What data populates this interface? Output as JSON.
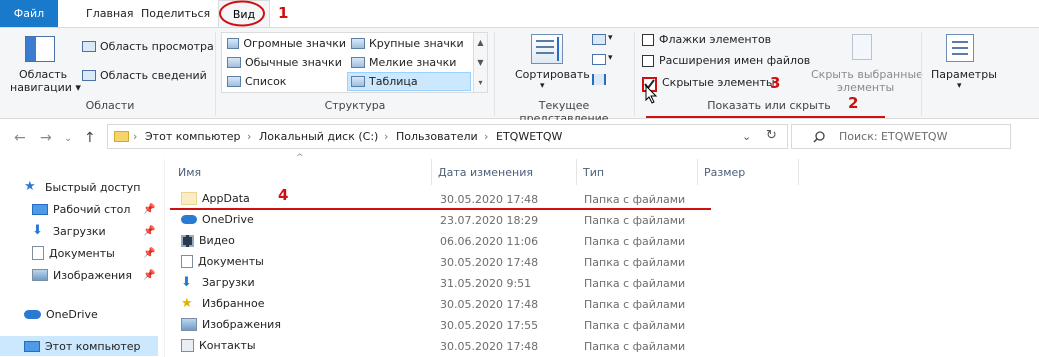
{
  "tabs": {
    "file": "Файл",
    "home": "Главная",
    "share": "Поделиться",
    "view": "Вид"
  },
  "ribbon": {
    "panes": {
      "nav_pane": [
        "Область",
        "навигации"
      ],
      "preview": "Область просмотра",
      "details": "Область сведений",
      "group_label": "Области"
    },
    "layout": {
      "items": [
        "Огромные значки",
        "Крупные значки",
        "Обычные значки",
        "Мелкие значки",
        "Список",
        "Таблица"
      ],
      "selected": "Таблица",
      "group_label": "Структура"
    },
    "current_view": {
      "sort": "Сортировать",
      "group_label": "Текущее представление"
    },
    "show_hide": {
      "item_checkboxes": "Флажки элементов",
      "file_extensions": "Расширения имен файлов",
      "hidden_items": "Скрытые элементы",
      "hidden_checked": true,
      "hide_selected": [
        "Скрыть выбранные",
        "элементы"
      ],
      "group_label": "Показать или скрыть"
    },
    "options": {
      "label": "Параметры"
    }
  },
  "address": {
    "crumbs": [
      "Этот компьютер",
      "Локальный диск (C:)",
      "Пользователи",
      "ETQWETQW"
    ],
    "search_placeholder": "Поиск: ETQWETQW"
  },
  "nav_pane_items": [
    {
      "label": "Быстрый доступ",
      "icon": "star-icon"
    },
    {
      "label": "Рабочий стол",
      "icon": "desktop-icon",
      "pinned": true
    },
    {
      "label": "Загрузки",
      "icon": "download-icon",
      "pinned": true
    },
    {
      "label": "Документы",
      "icon": "document-icon",
      "pinned": true
    },
    {
      "label": "Изображения",
      "icon": "pictures-icon",
      "pinned": true
    },
    {
      "label": "OneDrive",
      "icon": "cloud-icon"
    },
    {
      "label": "Этот компьютер",
      "icon": "computer-icon"
    }
  ],
  "columns": [
    "Имя",
    "Дата изменения",
    "Тип",
    "Размер"
  ],
  "files": [
    {
      "name": "AppData",
      "date": "30.05.2020 17:48",
      "type": "Папка с файлами",
      "icon": "folder-hidden-icon"
    },
    {
      "name": "OneDrive",
      "date": "23.07.2020 18:29",
      "type": "Папка с файлами",
      "icon": "cloud-icon"
    },
    {
      "name": "Видео",
      "date": "06.06.2020 11:06",
      "type": "Папка с файлами",
      "icon": "video-icon"
    },
    {
      "name": "Документы",
      "date": "30.05.2020 17:48",
      "type": "Папка с файлами",
      "icon": "document-icon"
    },
    {
      "name": "Загрузки",
      "date": "31.05.2020 9:51",
      "type": "Папка с файлами",
      "icon": "download-icon"
    },
    {
      "name": "Избранное",
      "date": "30.05.2020 17:48",
      "type": "Папка с файлами",
      "icon": "star-icon"
    },
    {
      "name": "Изображения",
      "date": "30.05.2020 17:55",
      "type": "Папка с файлами",
      "icon": "pictures-icon"
    },
    {
      "name": "Контакты",
      "date": "30.05.2020 17:48",
      "type": "Папка с файлами",
      "icon": "contacts-icon"
    }
  ],
  "annotations": [
    "1",
    "2",
    "3",
    "4"
  ],
  "colors": {
    "accent": "#1979ca",
    "annotation": "#d01010",
    "selected_bg": "#cce8ff"
  }
}
